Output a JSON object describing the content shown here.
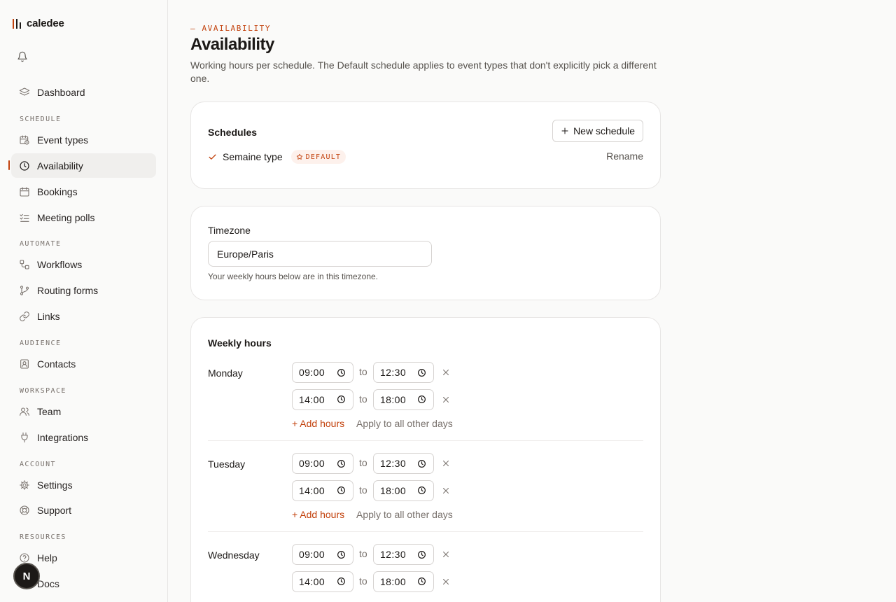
{
  "app": {
    "name": "caledee"
  },
  "sidebar": {
    "dashboard": "Dashboard",
    "sections": {
      "schedule": "SCHEDULE",
      "automate": "AUTOMATE",
      "audience": "AUDIENCE",
      "workspace": "WORKSPACE",
      "account": "ACCOUNT",
      "resources": "RESOURCES"
    },
    "items": {
      "event_types": "Event types",
      "availability": "Availability",
      "bookings": "Bookings",
      "meeting_polls": "Meeting polls",
      "workflows": "Workflows",
      "routing_forms": "Routing forms",
      "links": "Links",
      "contacts": "Contacts",
      "team": "Team",
      "integrations": "Integrations",
      "settings": "Settings",
      "support": "Support",
      "help": "Help",
      "docs": "Docs"
    },
    "active": "availability",
    "avatar_initial": "N"
  },
  "page": {
    "eyebrow": "— AVAILABILITY",
    "title": "Availability",
    "description": "Working hours per schedule. The Default schedule applies to event types that don't explicitly pick a different one."
  },
  "schedules": {
    "title": "Schedules",
    "new_button": "New schedule",
    "current": {
      "name": "Semaine type",
      "badge": "DEFAULT",
      "rename": "Rename"
    }
  },
  "timezone": {
    "label": "Timezone",
    "value": "Europe/Paris",
    "hint": "Your weekly hours below are in this timezone."
  },
  "weekly": {
    "title": "Weekly hours",
    "to_label": "to",
    "add_hours": "+ Add hours",
    "apply_all": "Apply to all other days",
    "days": [
      {
        "name": "Monday",
        "slots": [
          {
            "start": "09:00",
            "end": "12:30"
          },
          {
            "start": "14:00",
            "end": "18:00"
          }
        ]
      },
      {
        "name": "Tuesday",
        "slots": [
          {
            "start": "09:00",
            "end": "12:30"
          },
          {
            "start": "14:00",
            "end": "18:00"
          }
        ]
      },
      {
        "name": "Wednesday",
        "slots": [
          {
            "start": "09:00",
            "end": "12:30"
          },
          {
            "start": "14:00",
            "end": "18:00"
          }
        ]
      }
    ]
  },
  "colors": {
    "accent": "#c2410c",
    "accent_bg": "#fdf1ec",
    "active_nav_bg": "#f0efed"
  }
}
